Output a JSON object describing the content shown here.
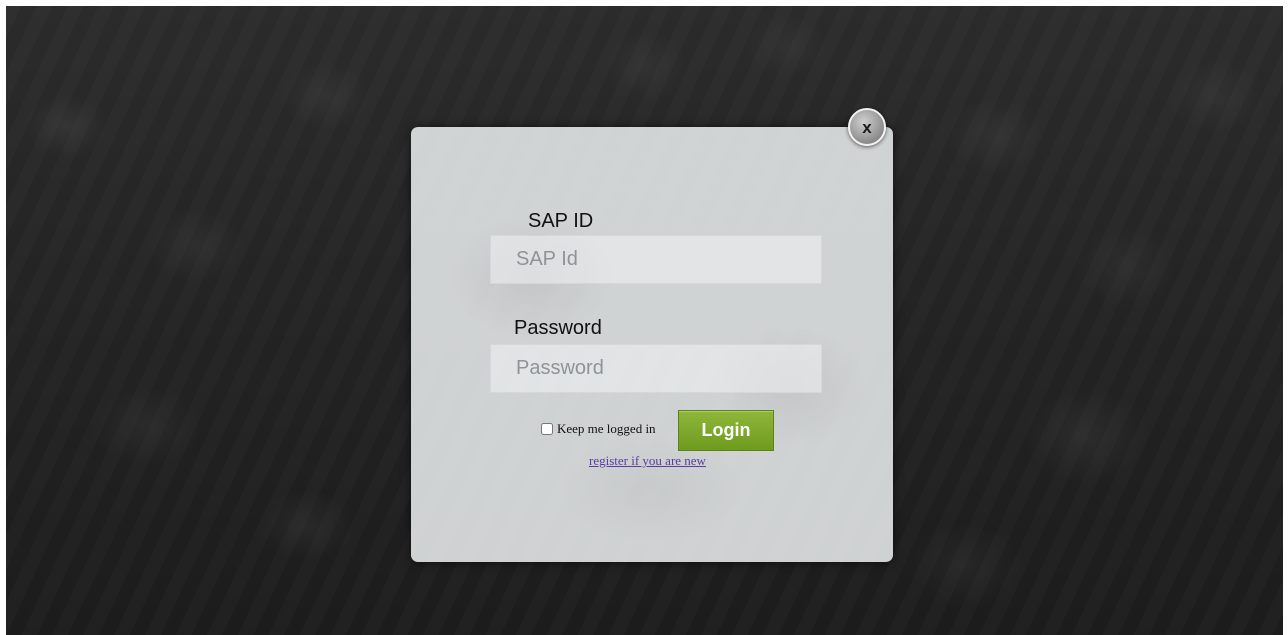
{
  "login_form": {
    "sap_id_label": "SAP ID",
    "sap_id_placeholder": "SAP Id",
    "password_label": "Password",
    "password_placeholder": "Password",
    "remember_label": "Keep me logged in",
    "login_button": "Login",
    "register_link": "register if you are new"
  },
  "close_button": {
    "label": "x"
  },
  "colors": {
    "login_button": "#7aa529",
    "link": "#5b3c9e",
    "backdrop": "#242424"
  }
}
